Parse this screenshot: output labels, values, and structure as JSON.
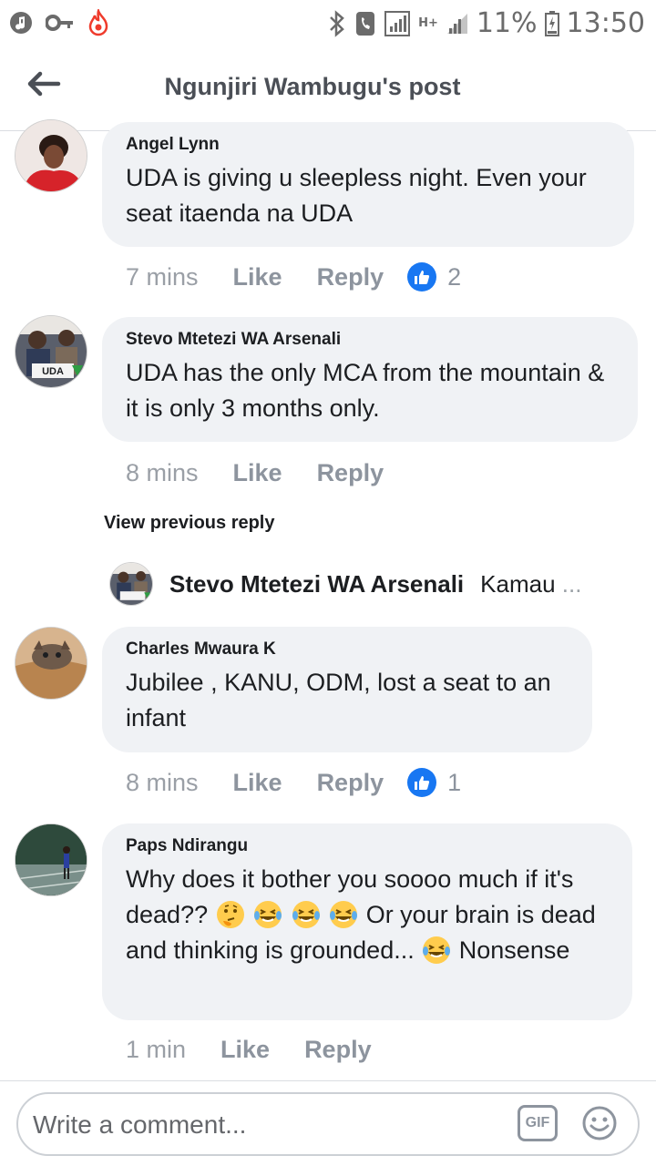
{
  "status_bar": {
    "battery_percent": "11%",
    "time": "13:50",
    "network_label": "H+"
  },
  "header": {
    "title": "Ngunjiri Wambugu's post"
  },
  "comments": [
    {
      "author": "Angel Lynn",
      "text": "UDA is giving u sleepless night. Even your seat itaenda na UDA",
      "time": "7 mins",
      "like_label": "Like",
      "reply_label": "Reply",
      "reaction_count": "2"
    },
    {
      "author": "Stevo Mtetezi WA Arsenali",
      "text": "UDA has the only MCA from the mountain & it is only 3 months only.",
      "time": "8 mins",
      "like_label": "Like",
      "reply_label": "Reply",
      "avatar_badge": "UDA"
    },
    {
      "author": "Charles Mwaura K",
      "text": "Jubilee , KANU, ODM, lost a seat to an infant",
      "time": "8 mins",
      "like_label": "Like",
      "reply_label": "Reply",
      "reaction_count": "1"
    },
    {
      "author": "Paps Ndirangu",
      "text_part1": "Why does it bother you soooo much if it's dead??",
      "text_part2": "Or your brain is dead and thinking is grounded...",
      "text_part3": "Nonsense",
      "time": "1 min",
      "like_label": "Like",
      "reply_label": "Reply"
    }
  ],
  "replies": {
    "view_previous_label": "View previous reply",
    "preview_author": "Stevo Mtetezi WA Arsenali",
    "preview_snippet": "Kamau",
    "preview_ellipsis": "..."
  },
  "composer": {
    "placeholder": "Write a comment...",
    "gif_label": "GIF"
  },
  "colors": {
    "accent_blue": "#1877f2",
    "bubble_bg": "#f0f2f5",
    "meta_gray": "#8d949e"
  }
}
